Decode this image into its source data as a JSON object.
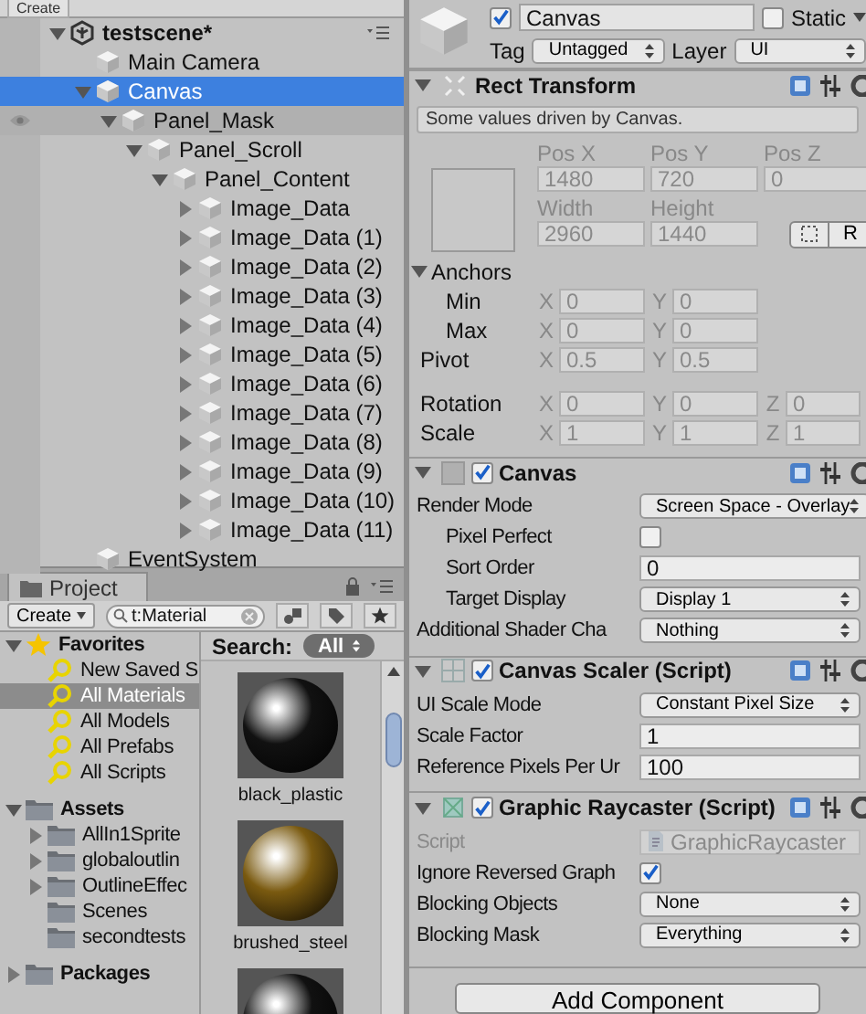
{
  "hierarchy": {
    "toolbar": {
      "create": "Create"
    },
    "scene": {
      "name": "testscene*",
      "expandable": true,
      "expanded": true,
      "children": [
        {
          "name": "Main Camera",
          "expandable": false,
          "expanded": false,
          "selected": false,
          "hovered": false
        },
        {
          "name": "Canvas",
          "expandable": true,
          "expanded": true,
          "selected": true,
          "hovered": false,
          "children": [
            {
              "name": "Panel_Mask",
              "expandable": true,
              "expanded": true,
              "selected": false,
              "hovered": true,
              "children": [
                {
                  "name": "Panel_Scroll",
                  "expandable": true,
                  "expanded": true,
                  "selected": false,
                  "hovered": false,
                  "children": [
                    {
                      "name": "Panel_Content",
                      "expandable": true,
                      "expanded": true,
                      "selected": false,
                      "hovered": false,
                      "children": [
                        {
                          "name": "Image_Data",
                          "expandable": true,
                          "expanded": false,
                          "selected": false,
                          "hovered": false
                        },
                        {
                          "name": "Image_Data (1)",
                          "expandable": true,
                          "expanded": false,
                          "selected": false,
                          "hovered": false
                        },
                        {
                          "name": "Image_Data (2)",
                          "expandable": true,
                          "expanded": false,
                          "selected": false,
                          "hovered": false
                        },
                        {
                          "name": "Image_Data (3)",
                          "expandable": true,
                          "expanded": false,
                          "selected": false,
                          "hovered": false
                        },
                        {
                          "name": "Image_Data (4)",
                          "expandable": true,
                          "expanded": false,
                          "selected": false,
                          "hovered": false
                        },
                        {
                          "name": "Image_Data (5)",
                          "expandable": true,
                          "expanded": false,
                          "selected": false,
                          "hovered": false
                        },
                        {
                          "name": "Image_Data (6)",
                          "expandable": true,
                          "expanded": false,
                          "selected": false,
                          "hovered": false
                        },
                        {
                          "name": "Image_Data (7)",
                          "expandable": true,
                          "expanded": false,
                          "selected": false,
                          "hovered": false
                        },
                        {
                          "name": "Image_Data (8)",
                          "expandable": true,
                          "expanded": false,
                          "selected": false,
                          "hovered": false
                        },
                        {
                          "name": "Image_Data (9)",
                          "expandable": true,
                          "expanded": false,
                          "selected": false,
                          "hovered": false
                        },
                        {
                          "name": "Image_Data (10)",
                          "expandable": true,
                          "expanded": false,
                          "selected": false,
                          "hovered": false
                        },
                        {
                          "name": "Image_Data (11)",
                          "expandable": true,
                          "expanded": false,
                          "selected": false,
                          "hovered": false
                        }
                      ]
                    }
                  ]
                }
              ]
            }
          ]
        },
        {
          "name": "EventSystem",
          "expandable": false,
          "expanded": false,
          "selected": false,
          "hovered": false
        }
      ]
    }
  },
  "project": {
    "tab": "Project",
    "toolbar": {
      "create": "Create",
      "search": "t:Material"
    },
    "tree": [
      {
        "name": "Favorites",
        "kind": "favorites",
        "expandable": true,
        "expanded": true,
        "selected": false,
        "children": [
          {
            "name": "New Saved S",
            "kind": "search",
            "expandable": false,
            "expanded": false,
            "selected": false
          },
          {
            "name": "All Materials",
            "kind": "search",
            "expandable": false,
            "expanded": false,
            "selected": true
          },
          {
            "name": "All Models",
            "kind": "search",
            "expandable": false,
            "expanded": false,
            "selected": false
          },
          {
            "name": "All Prefabs",
            "kind": "search",
            "expandable": false,
            "expanded": false,
            "selected": false
          },
          {
            "name": "All Scripts",
            "kind": "search",
            "expandable": false,
            "expanded": false,
            "selected": false
          }
        ]
      },
      {
        "name": "Assets",
        "kind": "folder",
        "expandable": true,
        "expanded": true,
        "selected": false,
        "children": [
          {
            "name": "AllIn1Sprite",
            "kind": "folder",
            "expandable": true,
            "expanded": false,
            "selected": false
          },
          {
            "name": "globaloutlin",
            "kind": "folder",
            "expandable": true,
            "expanded": false,
            "selected": false
          },
          {
            "name": "OutlineEffec",
            "kind": "folder",
            "expandable": true,
            "expanded": false,
            "selected": false
          },
          {
            "name": "Scenes",
            "kind": "folder",
            "expandable": false,
            "expanded": false,
            "selected": false
          },
          {
            "name": "secondtests",
            "kind": "folder",
            "expandable": false,
            "expanded": false,
            "selected": false
          }
        ]
      },
      {
        "name": "Packages",
        "kind": "folder",
        "expandable": true,
        "expanded": false,
        "selected": false
      }
    ],
    "search_bar": {
      "label": "Search:",
      "scope": "All"
    },
    "assets": [
      {
        "name": "black_plastic",
        "color": "#111111"
      },
      {
        "name": "brushed_steel",
        "color": "#7a5a10"
      },
      {
        "color": "#111111"
      }
    ]
  },
  "inspector": {
    "object": {
      "enabled": true,
      "name": "Canvas",
      "static": false,
      "static_label": "Static",
      "tag_label": "Tag",
      "tag": "Untagged",
      "layer_label": "Layer",
      "layer": "UI"
    },
    "components": [
      {
        "kind": "rect_transform",
        "title": "Rect Transform",
        "expanded": true,
        "driven": true,
        "note": "Some values driven by Canvas.",
        "fields": [
          {
            "label": "Pos X",
            "value": "1480"
          },
          {
            "label": "Pos Y",
            "value": "720"
          },
          {
            "label": "Pos Z",
            "value": "0"
          },
          {
            "label": "Width",
            "value": "2960"
          },
          {
            "label": "Height",
            "value": "1440"
          }
        ],
        "raw_button": "R",
        "anchors": {
          "label": "Anchors",
          "expanded": true,
          "rows": [
            {
              "label": "Min",
              "values": [
                {
                  "axis": "X",
                  "value": "0"
                },
                {
                  "axis": "Y",
                  "value": "0"
                }
              ]
            },
            {
              "label": "Max",
              "values": [
                {
                  "axis": "X",
                  "value": "0"
                },
                {
                  "axis": "Y",
                  "value": "0"
                }
              ]
            }
          ]
        },
        "vector_groups": [
          [
            {
              "label": "Pivot",
              "values": [
                {
                  "axis": "X",
                  "value": "0.5"
                },
                {
                  "axis": "Y",
                  "value": "0.5"
                }
              ]
            }
          ],
          [
            {
              "label": "Rotation",
              "values": [
                {
                  "axis": "X",
                  "value": "0"
                },
                {
                  "axis": "Y",
                  "value": "0"
                },
                {
                  "axis": "Z",
                  "value": "0"
                }
              ]
            },
            {
              "label": "Scale",
              "values": [
                {
                  "axis": "X",
                  "value": "1"
                },
                {
                  "axis": "Y",
                  "value": "1"
                },
                {
                  "axis": "Z",
                  "value": "1"
                }
              ]
            }
          ]
        ]
      },
      {
        "kind": "canvas",
        "title": "Canvas",
        "expanded": true,
        "enabled": true,
        "properties": [
          {
            "label": "Render Mode",
            "kind": "dropdown",
            "value": "Screen Space - Overlay",
            "disabled": false,
            "children": [
              {
                "label": "Pixel Perfect",
                "kind": "checkbox",
                "checked": false,
                "disabled": false
              },
              {
                "label": "Sort Order",
                "kind": "field",
                "value": "0",
                "disabled": false
              },
              {
                "label": "Target Display",
                "kind": "dropdown",
                "value": "Display 1",
                "disabled": false
              }
            ]
          },
          {
            "label": "Additional Shader Cha",
            "kind": "dropdown",
            "value": "Nothing",
            "disabled": false
          }
        ]
      },
      {
        "kind": "canvas_scaler",
        "title": "Canvas Scaler (Script)",
        "expanded": true,
        "enabled": true,
        "properties": [
          {
            "label": "UI Scale Mode",
            "kind": "dropdown",
            "value": "Constant Pixel Size",
            "disabled": false
          },
          {
            "label": "Scale Factor",
            "kind": "field",
            "value": "1",
            "disabled": false
          },
          {
            "label": "Reference Pixels Per Ur",
            "kind": "field",
            "value": "100",
            "disabled": false
          }
        ]
      },
      {
        "kind": "graphic_raycaster",
        "title": "Graphic Raycaster (Script)",
        "expanded": true,
        "enabled": true,
        "properties": [
          {
            "label": "Script",
            "kind": "object",
            "value": "GraphicRaycaster",
            "disabled": true
          },
          {
            "label": "Ignore Reversed Graph",
            "kind": "checkbox",
            "checked": true,
            "disabled": false
          },
          {
            "label": "Blocking Objects",
            "kind": "dropdown",
            "value": "None",
            "disabled": false
          },
          {
            "label": "Blocking Mask",
            "kind": "dropdown",
            "value": "Everything",
            "disabled": false
          }
        ]
      }
    ],
    "add_component": "Add Component"
  }
}
